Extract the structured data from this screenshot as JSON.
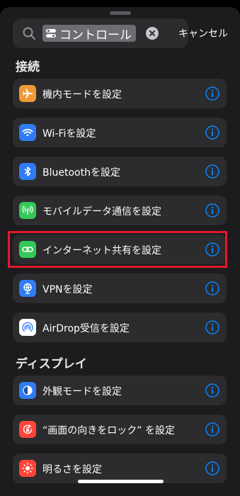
{
  "search": {
    "token_text": "コントロール",
    "cancel_label": "キャンセル"
  },
  "sections": [
    {
      "title": "接続"
    },
    {
      "title": "ディスプレイ"
    }
  ],
  "items": [
    {
      "label": "機内モードを設定",
      "icon": "airplane-icon",
      "color": "#f09a37"
    },
    {
      "label": "Wi-Fiを設定",
      "icon": "wifi-icon",
      "color": "#2f7cf6"
    },
    {
      "label": "Bluetoothを設定",
      "icon": "bluetooth-icon",
      "color": "#2f7cf6"
    },
    {
      "label": "モバイルデータ通信を設定",
      "icon": "cellular-antenna-icon",
      "color": "#34c759"
    },
    {
      "label": "インターネット共有を設定",
      "icon": "link-icon",
      "color": "#34c759"
    },
    {
      "label": "VPNを設定",
      "icon": "globe-vpn-icon",
      "color": "#2f7cf6"
    },
    {
      "label": "AirDrop受信を設定",
      "icon": "airdrop-icon",
      "color": "#ffffff"
    },
    {
      "label": "外観モードを設定",
      "icon": "appearance-icon",
      "color": "#2f7cf6"
    },
    {
      "label": "“画面の向きをロック” を設定",
      "icon": "rotation-lock-icon",
      "color": "#ff453a"
    },
    {
      "label": "明るさを設定",
      "icon": "sun-icon",
      "color": "#ff453a"
    }
  ],
  "colors": {
    "accent": "#0a84ff",
    "highlight_border": "#e8162b"
  }
}
